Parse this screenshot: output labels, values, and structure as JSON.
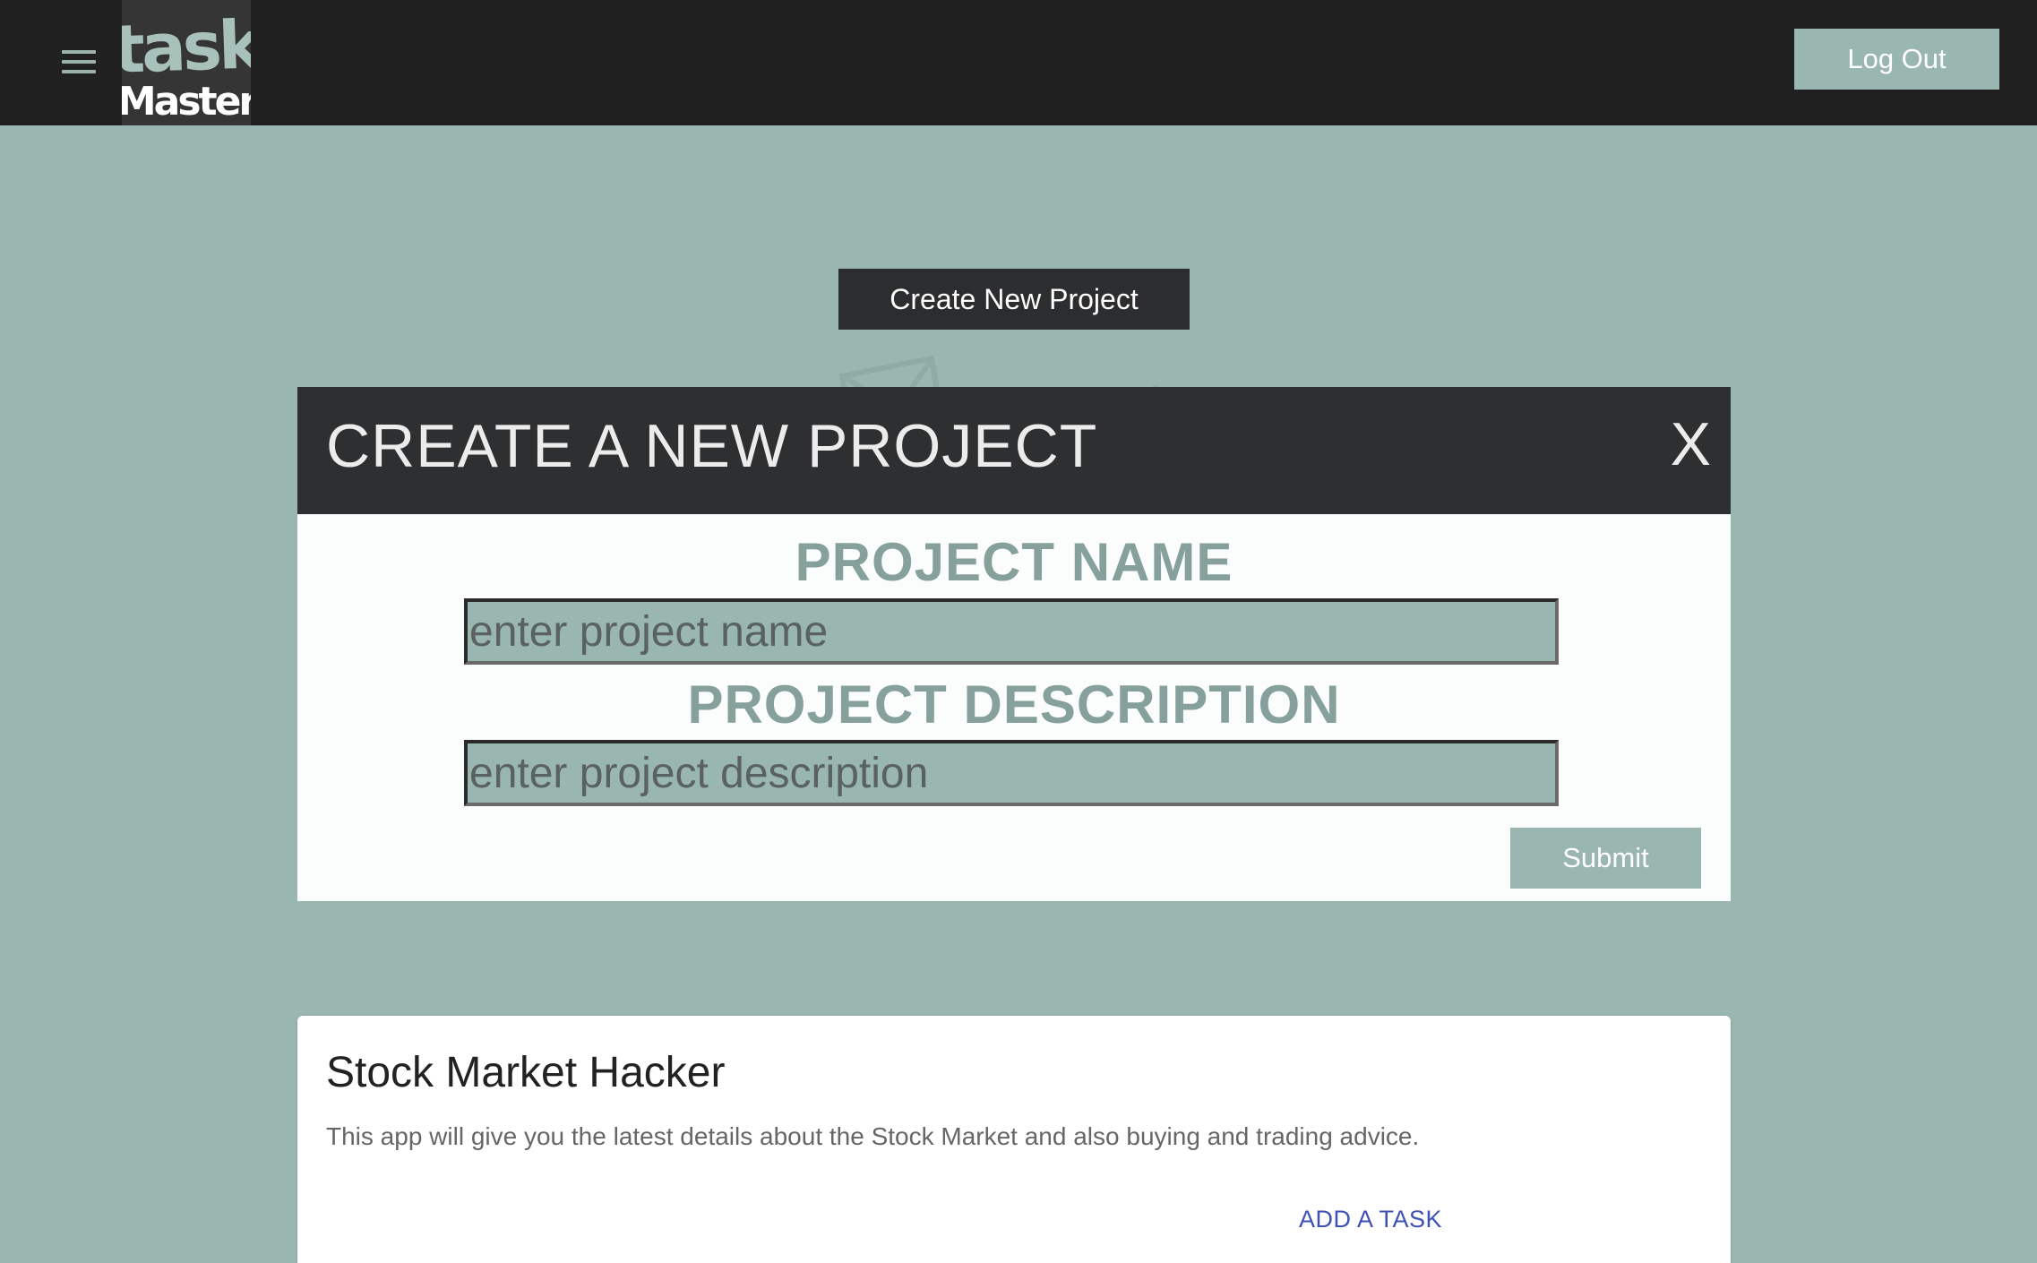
{
  "header": {
    "menu_icon": "hamburger-menu-icon",
    "logo_text_top": "task",
    "logo_text_bottom": "Master",
    "logout_label": "Log Out"
  },
  "main": {
    "create_button_label": "Create New Project"
  },
  "modal": {
    "title": "CREATE A NEW PROJECT",
    "close_label": "X",
    "name_label": "PROJECT NAME",
    "name_placeholder": "enter project name",
    "description_label": "PROJECT DESCRIPTION",
    "description_placeholder": "enter project description",
    "submit_label": "Submit"
  },
  "projects": [
    {
      "title": "Stock Market Hacker",
      "description": "This app will give you the latest details about the Stock Market and also buying and trading advice.",
      "action_label": "ADD A TASK"
    }
  ],
  "colors": {
    "background": "#9ab6b1",
    "appbar": "#202020",
    "modal_header": "#2e2f31",
    "accent_text": "#86a19b",
    "link": "#3f51b5"
  }
}
